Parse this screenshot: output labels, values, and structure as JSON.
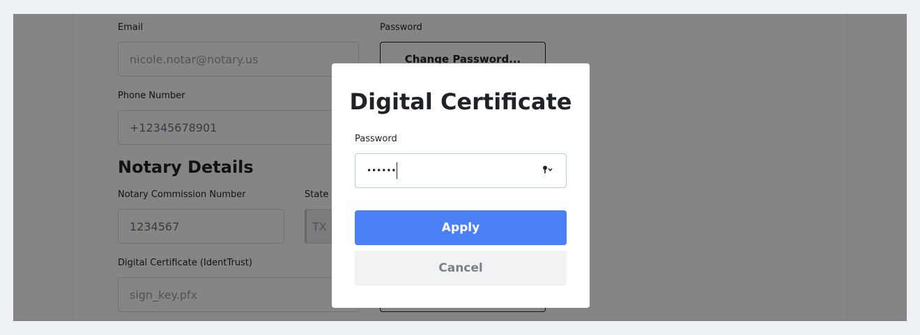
{
  "profile": {
    "email_label": "Email",
    "email_value": "nicole.notar@notary.us",
    "password_label": "Password",
    "change_password_label": "Change Password...",
    "phone_label": "Phone Number",
    "phone_value": "+12345678901",
    "section_title": "Notary Details",
    "commission_label": "Notary Commission Number",
    "commission_value": "1234567",
    "state_label": "State",
    "state_value": "TX",
    "certificate_label": "Digital Certificate (IdentTrust)",
    "certificate_value": "sign_key.pfx"
  },
  "modal": {
    "title": "Digital Certificate",
    "password_label": "Password",
    "password_value": "••••••",
    "password_icon": "key-icon",
    "apply_label": "Apply",
    "cancel_label": "Cancel"
  },
  "colors": {
    "primary": "#4a7ff5",
    "overlay": "rgba(0,0,0,0.48)",
    "cancel_bg": "#f1f2f4"
  }
}
